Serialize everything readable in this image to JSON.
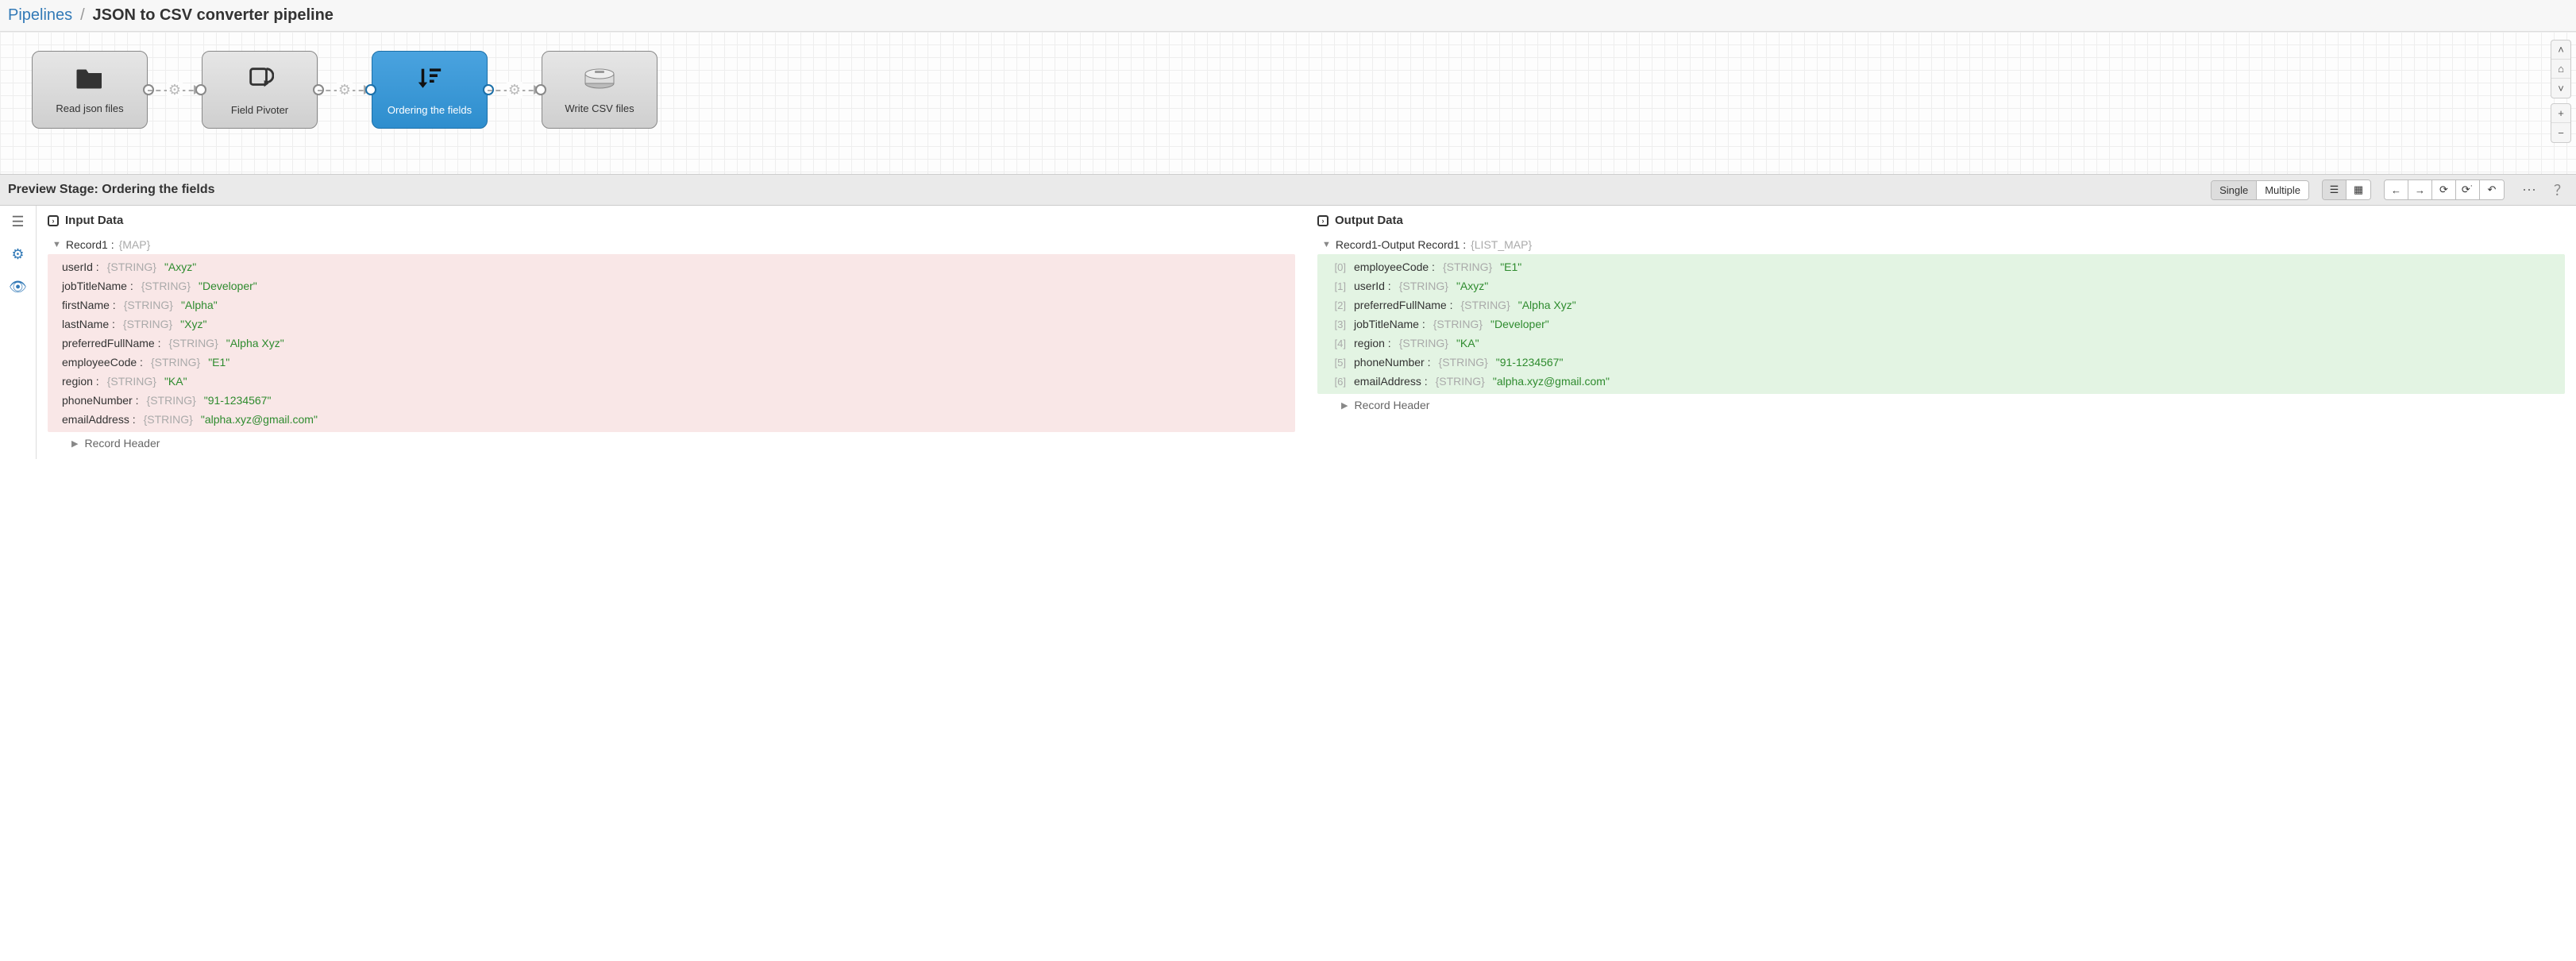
{
  "breadcrumb": {
    "root": "Pipelines",
    "title": "JSON to CSV converter pipeline"
  },
  "stages": [
    {
      "label": "Read json files",
      "icon": "folder",
      "selected": false,
      "hasLeft": false,
      "hasRight": true
    },
    {
      "label": "Field Pivoter",
      "icon": "pivot",
      "selected": false,
      "hasLeft": true,
      "hasRight": true
    },
    {
      "label": "Ordering the fields",
      "icon": "order",
      "selected": true,
      "hasLeft": true,
      "hasRight": true
    },
    {
      "label": "Write CSV files",
      "icon": "disk",
      "selected": false,
      "hasLeft": true,
      "hasRight": false
    }
  ],
  "preview": {
    "label": "Preview Stage: Ordering the fields",
    "modes": {
      "single": "Single",
      "multiple": "Multiple"
    }
  },
  "input": {
    "title": "Input Data",
    "record": {
      "name": "Record1 :",
      "type": "{MAP}"
    },
    "entries": [
      {
        "key": "userId :",
        "type": "{STRING}",
        "value": "\"Axyz\""
      },
      {
        "key": "jobTitleName :",
        "type": "{STRING}",
        "value": "\"Developer\""
      },
      {
        "key": "firstName :",
        "type": "{STRING}",
        "value": "\"Alpha\""
      },
      {
        "key": "lastName :",
        "type": "{STRING}",
        "value": "\"Xyz\""
      },
      {
        "key": "preferredFullName :",
        "type": "{STRING}",
        "value": "\"Alpha Xyz\""
      },
      {
        "key": "employeeCode :",
        "type": "{STRING}",
        "value": "\"E1\""
      },
      {
        "key": "region :",
        "type": "{STRING}",
        "value": "\"KA\""
      },
      {
        "key": "phoneNumber :",
        "type": "{STRING}",
        "value": "\"91-1234567\""
      },
      {
        "key": "emailAddress :",
        "type": "{STRING}",
        "value": "\"alpha.xyz@gmail.com\""
      }
    ],
    "recordHeader": "Record Header"
  },
  "output": {
    "title": "Output Data",
    "record": {
      "name": "Record1-Output Record1 :",
      "type": "{LIST_MAP}"
    },
    "entries": [
      {
        "idx": "[0]",
        "key": "employeeCode :",
        "type": "{STRING}",
        "value": "\"E1\""
      },
      {
        "idx": "[1]",
        "key": "userId :",
        "type": "{STRING}",
        "value": "\"Axyz\""
      },
      {
        "idx": "[2]",
        "key": "preferredFullName :",
        "type": "{STRING}",
        "value": "\"Alpha Xyz\""
      },
      {
        "idx": "[3]",
        "key": "jobTitleName :",
        "type": "{STRING}",
        "value": "\"Developer\""
      },
      {
        "idx": "[4]",
        "key": "region :",
        "type": "{STRING}",
        "value": "\"KA\""
      },
      {
        "idx": "[5]",
        "key": "phoneNumber :",
        "type": "{STRING}",
        "value": "\"91-1234567\""
      },
      {
        "idx": "[6]",
        "key": "emailAddress :",
        "type": "{STRING}",
        "value": "\"alpha.xyz@gmail.com\""
      }
    ],
    "recordHeader": "Record Header"
  }
}
